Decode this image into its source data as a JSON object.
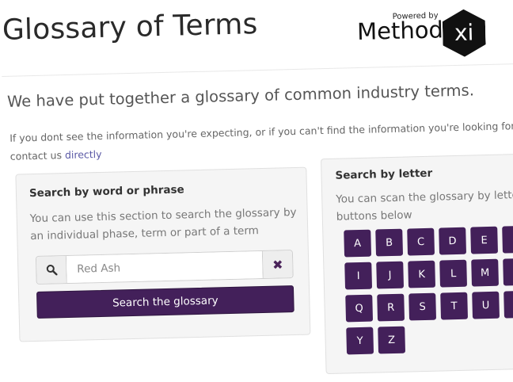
{
  "header": {
    "title": "Glossary of Terms",
    "brand": {
      "powered_by": "Powered by",
      "name": "Method",
      "mark": "xi"
    }
  },
  "intro": "We have put together a glossary of common industry terms.",
  "help": {
    "text": "If you dont see the information you're expecting, or if you can't find the information you're looking for y",
    "prefix": "contact us",
    "link": "directly"
  },
  "search_panel": {
    "heading": "Search by word or phrase",
    "description": "You can use this section to search the glossary by an individual phase, term or part of a term",
    "input_value": "Red Ash",
    "search_icon": "search-icon",
    "clear_icon": "close-icon",
    "button_label": "Search the glossary"
  },
  "letter_panel": {
    "heading": "Search by letter",
    "description": "You can scan the glossary by letter u buttons below",
    "letters": [
      "A",
      "B",
      "C",
      "D",
      "E",
      "F",
      "I",
      "J",
      "K",
      "L",
      "M",
      "N",
      "Q",
      "R",
      "S",
      "T",
      "U",
      "V",
      "Y",
      "Z"
    ]
  },
  "colors": {
    "accent": "#43205a",
    "link": "#5b5aa6",
    "panel_bg": "#f5f5f5"
  }
}
